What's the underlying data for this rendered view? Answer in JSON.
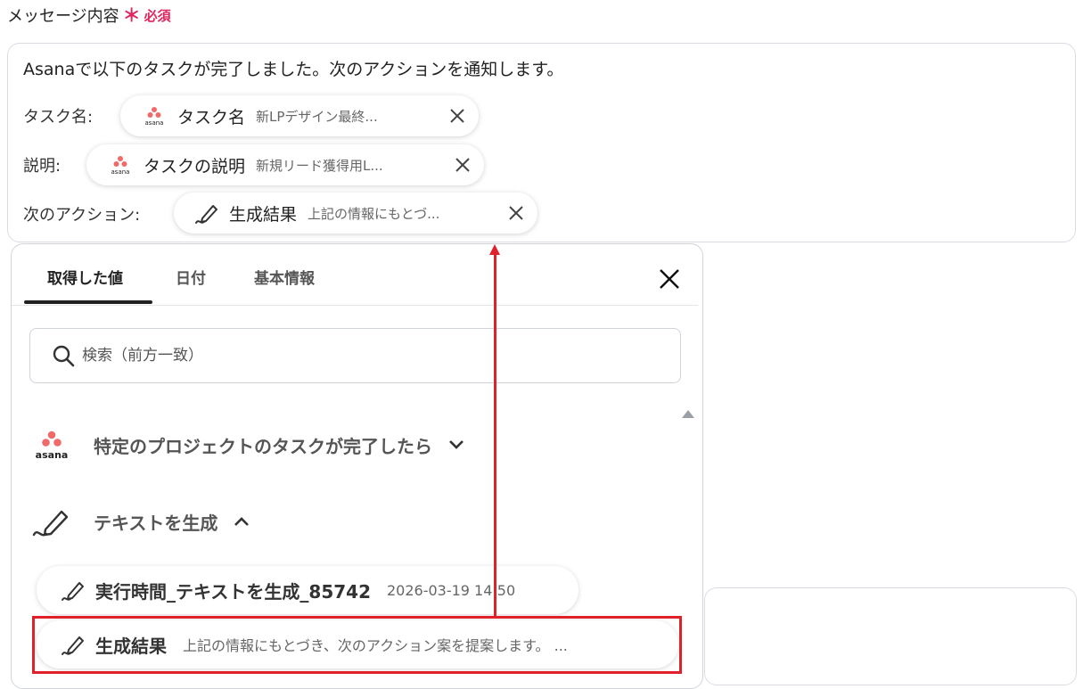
{
  "field": {
    "label": "メッセージ内容",
    "required_mark": "＊",
    "required_text": "必須"
  },
  "message": {
    "intro": "Asanaで以下のタスクが完了しました。次のアクションを通知します。",
    "rows": [
      {
        "label": "タスク名:",
        "pill_name": "タスク名",
        "pill_value": "新LPデザイン最終...",
        "icon": "asana-logo"
      },
      {
        "label": "説明:",
        "pill_name": "タスクの説明",
        "pill_value": "新規リード獲得用L...",
        "icon": "asana-logo"
      },
      {
        "label": "次のアクション:",
        "pill_name": "生成結果",
        "pill_value": "上記の情報にもとづ...",
        "icon": "pen-icon"
      }
    ]
  },
  "panel": {
    "tabs": [
      "取得した値",
      "日付",
      "基本情報"
    ],
    "active_tab": 0,
    "search_placeholder": "検索（前方一致）",
    "sections": [
      {
        "title": "特定のプロジェクトのタスクが完了したら",
        "icon": "asana-logo",
        "expanded": false
      },
      {
        "title": "テキストを生成",
        "icon": "pen-icon",
        "expanded": true
      }
    ],
    "items": [
      {
        "name": "実行時間_テキストを生成_85742",
        "value": "2026-03-19 14:50",
        "icon": "pen-icon"
      },
      {
        "name": "生成結果",
        "value": "上記の情報にもとづき、次のアクション案を提案します。 ...",
        "icon": "pen-icon"
      }
    ]
  },
  "colors": {
    "accent_red": "#e0202a",
    "required": "#e0245e",
    "asana": "#f06a6a"
  }
}
